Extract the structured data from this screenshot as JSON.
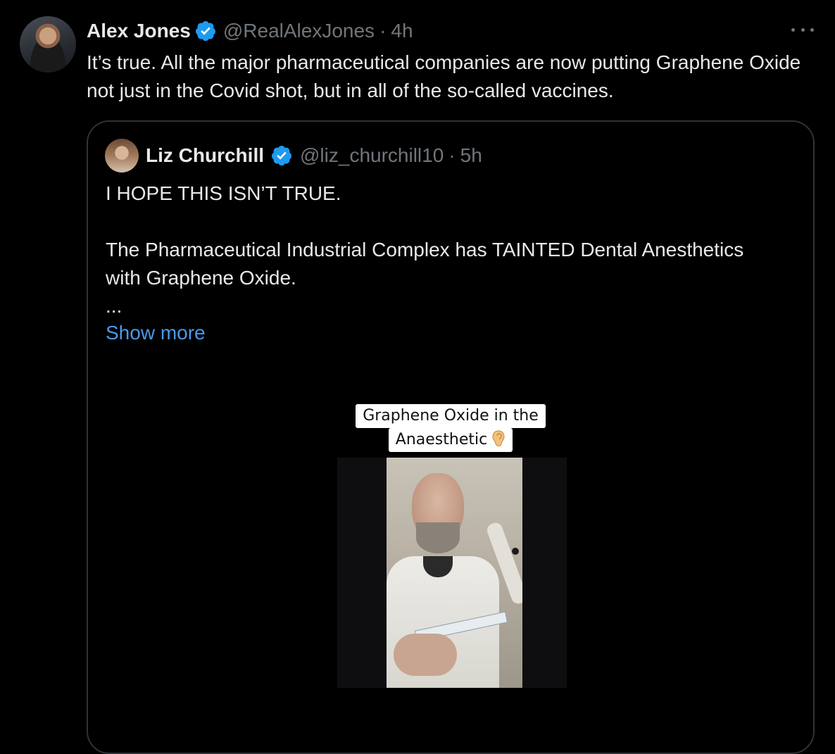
{
  "tweet": {
    "author": {
      "name": "Alex Jones",
      "handle": "@RealAlexJones",
      "time": "4h"
    },
    "text": "It’s true. All the major pharmaceutical companies are now putting Graphene Oxide not just in the Covid shot, but in all of the so-called vaccines.",
    "more_icon": "more-horizontal-icon"
  },
  "quote": {
    "author": {
      "name": "Liz Churchill",
      "handle": "@liz_churchill10",
      "time": "5h"
    },
    "lines": [
      "I HOPE THIS ISN’T TRUE.",
      "The Pharmaceutical Industrial Complex has TAINTED Dental Anesthetics with Graphene Oxide.",
      "..."
    ],
    "show_more": "Show more",
    "media": {
      "caption_line1": "Graphene Oxide in the",
      "caption_line2": "Anaesthetic",
      "caption_icon": "ear-icon"
    }
  },
  "colors": {
    "background": "#000000",
    "text": "#e7e9ea",
    "secondary": "#71767b",
    "link": "#4a99e9",
    "verified": "#1d9bf0",
    "border": "#2f3336"
  },
  "dot_separator": "·"
}
